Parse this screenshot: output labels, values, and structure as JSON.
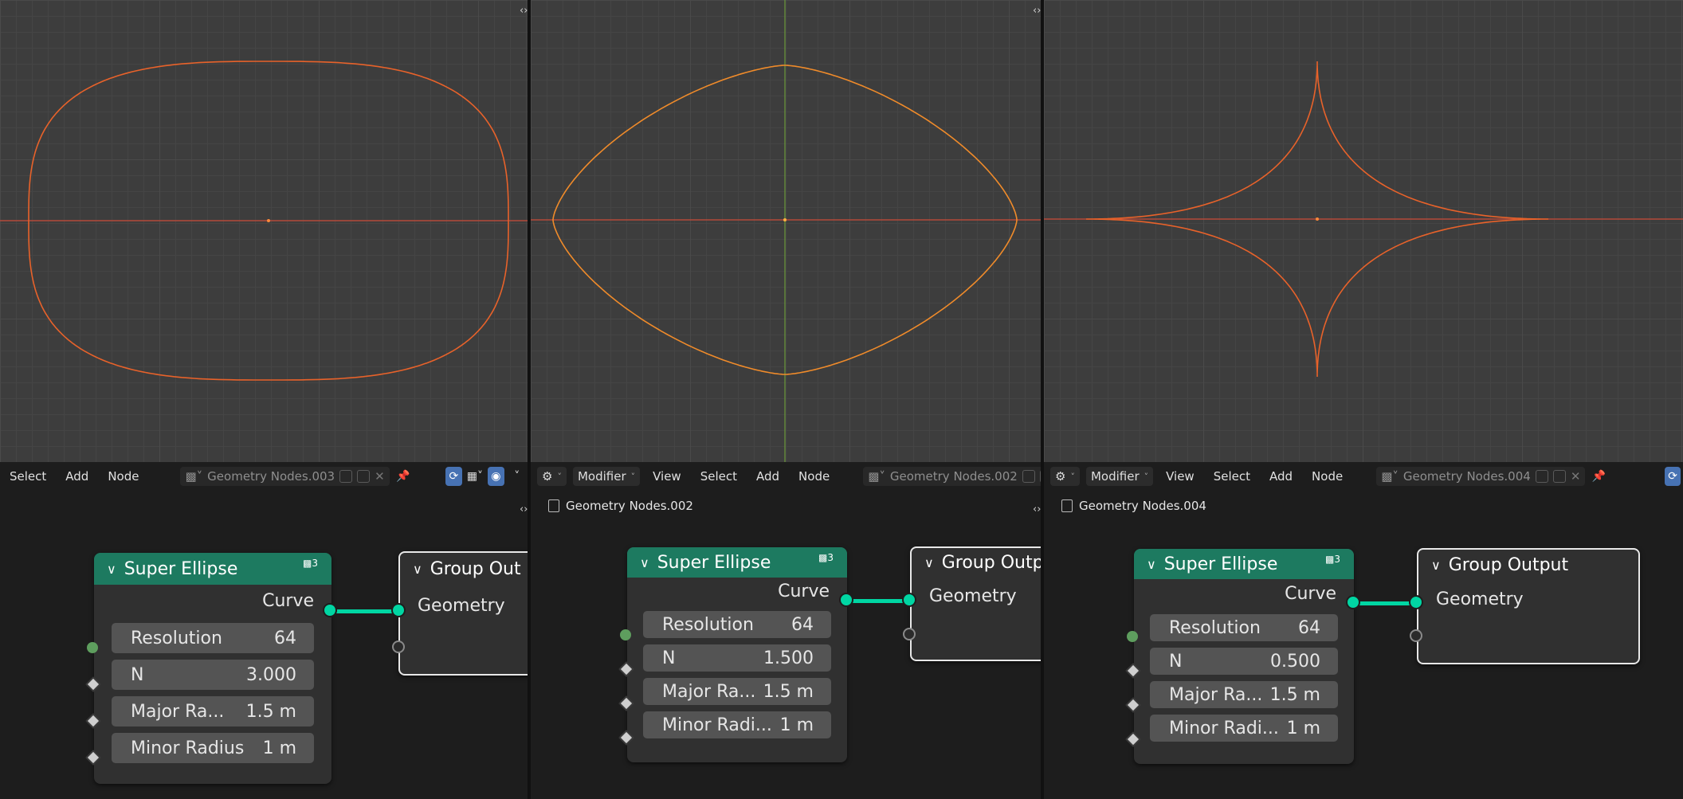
{
  "colors": {
    "curve_orange": "#e8622a",
    "curve_selected": "#f08b2a",
    "x_axis": "#b34a3a",
    "y_axis": "#6a9a3a",
    "node_group_header": "#1d7a60",
    "socket_teal": "#00d6a3",
    "header_active_blue": "#4772b3"
  },
  "panels": [
    {
      "header": {
        "menus": [
          "Select",
          "Add",
          "Node"
        ],
        "node_group": "Geometry Nodes.003"
      },
      "breadcrumb": "",
      "curve": {
        "n": 3.0
      },
      "node": {
        "title": "Super Ellipse",
        "badge": "3",
        "output": "Curve",
        "fields": [
          {
            "label": "Resolution",
            "value": "64"
          },
          {
            "label": "N",
            "value": "3.000"
          },
          {
            "label": "Major Ra...",
            "value": "1.5 m"
          },
          {
            "label": "Minor Radius",
            "value": "1 m"
          }
        ]
      },
      "output_node": {
        "title": "Group Out",
        "input": "Geometry"
      }
    },
    {
      "header": {
        "editor_type": "Modifier",
        "menus": [
          "View",
          "Select",
          "Add",
          "Node"
        ],
        "node_group": "Geometry Nodes.002"
      },
      "breadcrumb": "Geometry Nodes.002",
      "curve": {
        "n": 1.5
      },
      "node": {
        "title": "Super Ellipse",
        "badge": "3",
        "output": "Curve",
        "fields": [
          {
            "label": "Resolution",
            "value": "64"
          },
          {
            "label": "N",
            "value": "1.500"
          },
          {
            "label": "Major Ra...",
            "value": "1.5 m"
          },
          {
            "label": "Minor Radi...",
            "value": "1 m"
          }
        ]
      },
      "output_node": {
        "title": "Group Outp",
        "input": "Geometry"
      }
    },
    {
      "header": {
        "editor_type": "Modifier",
        "menus": [
          "View",
          "Select",
          "Add",
          "Node"
        ],
        "node_group": "Geometry Nodes.004"
      },
      "breadcrumb": "Geometry Nodes.004",
      "curve": {
        "n": 0.5
      },
      "node": {
        "title": "Super Ellipse",
        "badge": "3",
        "output": "Curve",
        "fields": [
          {
            "label": "Resolution",
            "value": "64"
          },
          {
            "label": "N",
            "value": "0.500"
          },
          {
            "label": "Major Ra...",
            "value": "1.5 m"
          },
          {
            "label": "Minor Radi...",
            "value": "1 m"
          }
        ]
      },
      "output_node": {
        "title": "Group Output",
        "input": "Geometry"
      }
    }
  ]
}
